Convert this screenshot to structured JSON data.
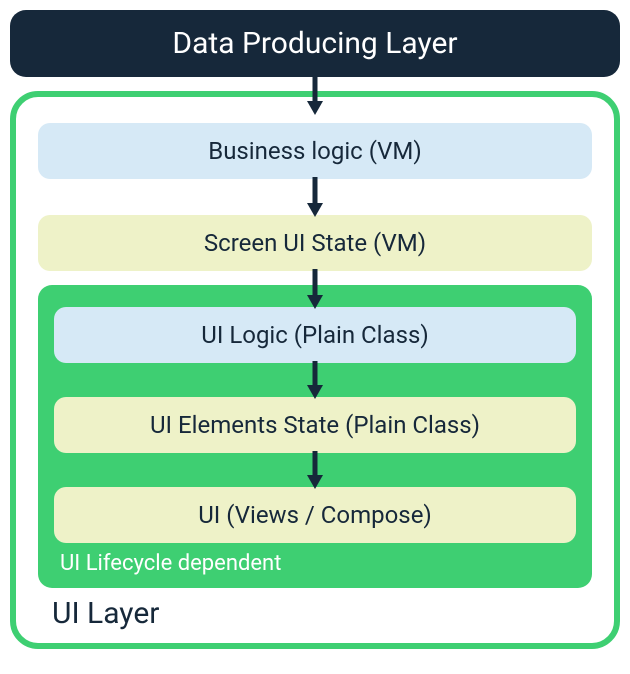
{
  "data_layer": {
    "title": "Data Producing Layer"
  },
  "ui_layer": {
    "label": "UI Layer",
    "boxes": {
      "business_logic": "Business logic (VM)",
      "screen_ui_state": "Screen UI State (VM)"
    },
    "lifecycle": {
      "label": "UI Lifecycle dependent",
      "boxes": {
        "ui_logic": "UI Logic (Plain Class)",
        "ui_elements_state": "UI Elements State (Plain Class)",
        "ui_views": "UI (Views / Compose)"
      }
    }
  },
  "colors": {
    "dark": "#16283a",
    "green": "#3ecf72",
    "blue": "#d6e9f6",
    "yellow": "#eef2c8"
  }
}
